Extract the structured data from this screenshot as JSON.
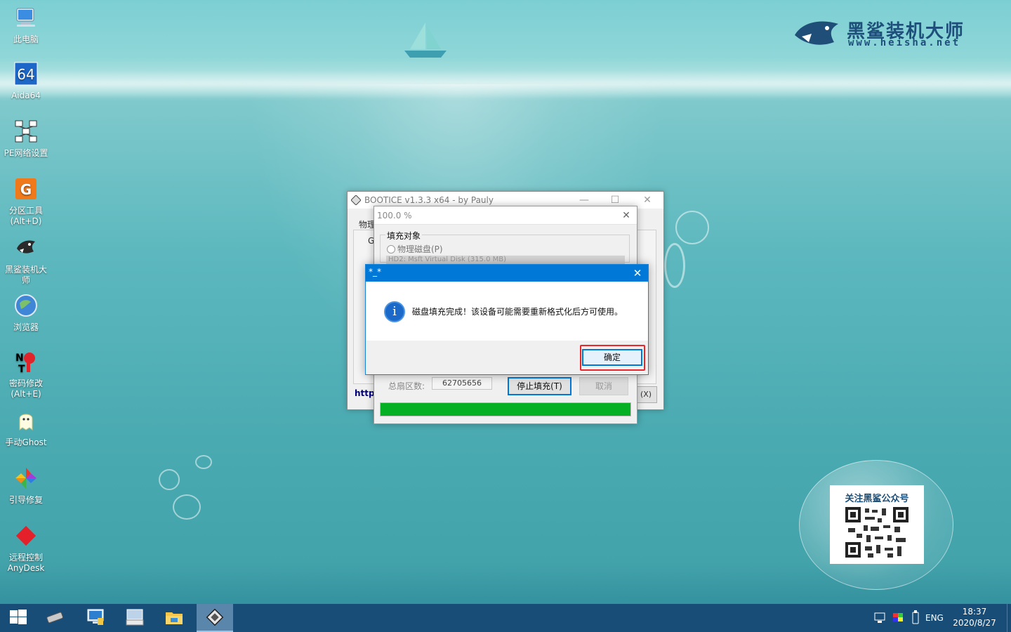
{
  "desktop": {
    "icons": [
      {
        "label": "此电脑",
        "icon": "computer-icon"
      },
      {
        "label": "Aida64",
        "icon": "aida64-icon"
      },
      {
        "label": "PE网络设置",
        "icon": "network-icon"
      },
      {
        "label": "分区工具\n(Alt+D)",
        "icon": "partition-tool-icon"
      },
      {
        "label": "黑鲨装机大师",
        "icon": "shark-icon"
      },
      {
        "label": "浏览器",
        "icon": "browser-icon"
      },
      {
        "label": "密码修改\n(Alt+E)",
        "icon": "password-icon"
      },
      {
        "label": "手动Ghost",
        "icon": "ghost-icon"
      },
      {
        "label": "引导修复",
        "icon": "boot-repair-icon"
      },
      {
        "label": "远程控制\nAnyDesk",
        "icon": "anydesk-icon"
      }
    ]
  },
  "logo": {
    "name": "黑鲨装机大师",
    "url": "www.heisha.net"
  },
  "qr": {
    "title": "关注黑鲨公众号"
  },
  "main_window": {
    "title": "BOOTICE v1.3.3 x64 - by Pauly",
    "tab_fragment": "物理",
    "group_fragment": "G",
    "link_fragment": "http",
    "exit_fragment": "(X)"
  },
  "progress_window": {
    "title": "100.0 %",
    "group_label": "填充对象",
    "radio_label": "物理磁盘(P)",
    "disk_select": "HD2: Msft Virtual Disk (315.0 MB)",
    "sector_label": "总扇区数:",
    "sector_value": "62705656",
    "stop_button": "停止填充(T)",
    "cancel_button": "取消",
    "progress": 1.0
  },
  "message_box": {
    "title": "*_*",
    "message": "磁盘填充完成！该设备可能需要重新格式化后方可使用。",
    "ok_button": "确定",
    "icon": "info-icon"
  },
  "taskbar": {
    "items": [
      "start-icon",
      "disk-icon",
      "network-icon",
      "keyboard-icon",
      "file-explorer-icon",
      "bootice-icon"
    ],
    "language": "ENG",
    "time": "18:37",
    "date": "2020/8/27"
  },
  "colors": {
    "accent": "#0078d7",
    "progress": "#06b025",
    "highlight": "#e8262b",
    "taskbar": "#184d78"
  }
}
